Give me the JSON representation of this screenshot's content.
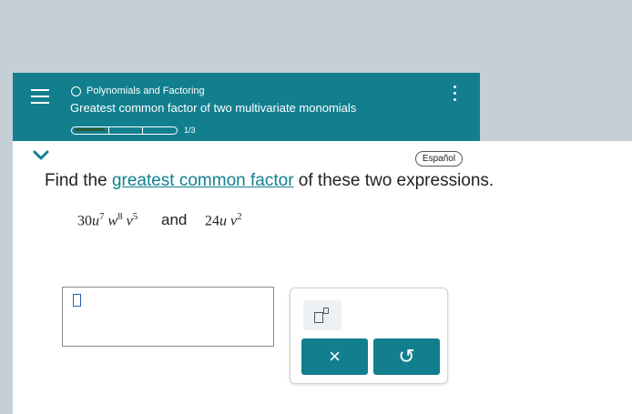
{
  "header": {
    "topic": "Polynomials and Factoring",
    "subtitle": "Greatest common factor of two multivariate monomials",
    "progress_text": "1/3",
    "progress_fraction": 0.333,
    "background_color": "#127f8f"
  },
  "language_button": "Español",
  "question": {
    "prefix": "Find the ",
    "link": "greatest common factor",
    "suffix": " of these two expressions."
  },
  "expressions": {
    "first": {
      "coef": "30",
      "u": "u",
      "u_exp": "7",
      "w": "w",
      "w_exp": "8",
      "v": "v",
      "v_exp": "5"
    },
    "connector": "and",
    "second": {
      "coef": "24",
      "u": "u",
      "v": "v",
      "v_exp": "2"
    }
  },
  "answer": {
    "value": ""
  },
  "tools": {
    "clear_symbol": "×",
    "undo_symbol": "↺",
    "exponent_icon": "box-with-superscript-icon"
  },
  "icons": [
    "menu-icon",
    "circle-icon",
    "kebab-menu-icon",
    "chevron-down-icon"
  ]
}
